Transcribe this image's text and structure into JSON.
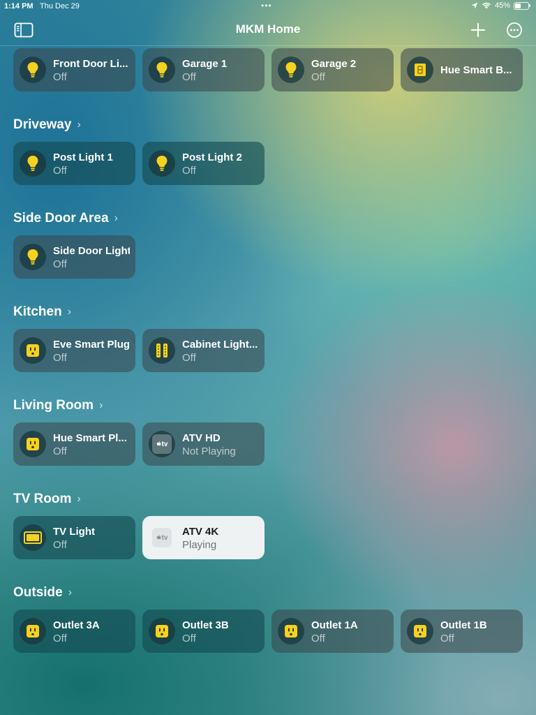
{
  "status_bar": {
    "time": "1:14 PM",
    "date": "Thu Dec 29",
    "multitask_dots": "•••",
    "battery_percent": "45%",
    "battery_level": 0.45
  },
  "nav": {
    "title": "MKM Home",
    "sidebar_icon": "sidebar-icon",
    "add_icon": "plus-icon",
    "more_icon": "ellipsis-circle-icon"
  },
  "top_row": [
    {
      "name": "Front Door Li...",
      "state": "Off",
      "icon": "bulb-icon"
    },
    {
      "name": "Garage 1",
      "state": "Off",
      "icon": "bulb-icon"
    },
    {
      "name": "Garage 2",
      "state": "Off",
      "icon": "bulb-icon"
    },
    {
      "name": "Hue Smart B...",
      "state": "",
      "icon": "switch-icon"
    }
  ],
  "sections": [
    {
      "title": "Driveway",
      "tiles": [
        {
          "name": "Post Light 1",
          "state": "Off",
          "icon": "bulb-icon"
        },
        {
          "name": "Post Light 2",
          "state": "Off",
          "icon": "bulb-icon"
        }
      ]
    },
    {
      "title": "Side Door Area",
      "tiles": [
        {
          "name": "Side Door Light",
          "state": "Off",
          "icon": "bulb-icon"
        }
      ]
    },
    {
      "title": "Kitchen",
      "tiles": [
        {
          "name": "Eve Smart Plug",
          "state": "Off",
          "icon": "outlet-icon"
        },
        {
          "name": "Cabinet Light...",
          "state": "Off",
          "icon": "lightstrip-icon"
        }
      ]
    },
    {
      "title": "Living Room",
      "tiles": [
        {
          "name": "Hue Smart Pl...",
          "state": "Off",
          "icon": "outlet-icon"
        },
        {
          "name": "ATV HD",
          "state": "Not Playing",
          "icon": "apple-tv-icon",
          "badge": "tv"
        }
      ]
    },
    {
      "title": "TV Room",
      "tiles": [
        {
          "name": "TV Light",
          "state": "Off",
          "icon": "tv-light-icon"
        },
        {
          "name": "ATV 4K",
          "state": "Playing",
          "icon": "apple-tv-icon",
          "badge": "tv"
        }
      ]
    },
    {
      "title": "Outside",
      "tiles": [
        {
          "name": "Outlet 3A",
          "state": "Off",
          "icon": "outlet-icon"
        },
        {
          "name": "Outlet 3B",
          "state": "Off",
          "icon": "outlet-icon"
        },
        {
          "name": "Outlet 1A",
          "state": "Off",
          "icon": "outlet-icon"
        },
        {
          "name": "Outlet 1B",
          "state": "Off",
          "icon": "outlet-icon"
        }
      ]
    }
  ],
  "section_chevron": "›",
  "colors": {
    "accessory_yellow": "#F5D21E",
    "active_tile": "#EEF2F3"
  }
}
